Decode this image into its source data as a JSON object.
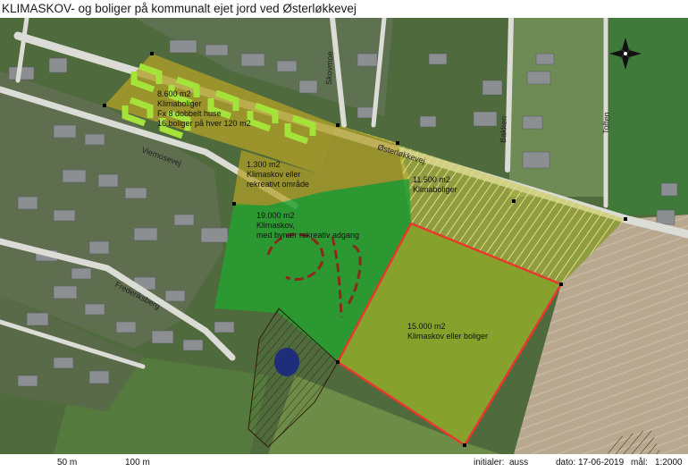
{
  "title": "KLIMASKOV- og boliger på kommunalt ejet jord ved Østerløkkevej",
  "roads": {
    "osterlokkevej": "Østerløkkevej",
    "viemosevej": "Viemosevej",
    "skovmoe": "Skovmoe",
    "bakken": "Bakken",
    "toften": "Toften",
    "frederiksberg": "Frederiksberg"
  },
  "areas": [
    {
      "id": "a1",
      "lines": [
        "8.600 m2",
        "Klimaboliger",
        "Fx 8 dobbelt huse",
        "16 boliger på hver 120 m2"
      ],
      "color": "#b9a63a"
    },
    {
      "id": "a2",
      "lines": [
        "1.300 m2",
        "Klimaskov eller",
        "rekreativt område"
      ],
      "color": "#b9a63a"
    },
    {
      "id": "a3",
      "lines": [
        "11.500 m2",
        "Klimaboliger"
      ],
      "color": "#d8d260"
    },
    {
      "id": "a4",
      "lines": [
        "19.000 m2",
        "Klimaskov,",
        "med bynær rekreativ adgang"
      ],
      "color": "#2fa83a"
    },
    {
      "id": "a5",
      "lines": [
        "15.000 m2",
        "Klimaskov eller boliger"
      ],
      "color": "#a9b832"
    }
  ],
  "scale": {
    "m50": "50 m",
    "m100": "100 m"
  },
  "footer": {
    "initials_label": "initialer:",
    "initials": "auss",
    "date_label": "dato:",
    "date": "17-06-2019",
    "scale_label": "mål:",
    "scale": "1:2000"
  },
  "colors": {
    "housing": "#b9a63a",
    "forest": "#2fa83a",
    "outline": "#e8382e",
    "house_block": "#a6e33a"
  },
  "icons": {
    "north": "compass-rose-icon",
    "pond": "pond"
  }
}
